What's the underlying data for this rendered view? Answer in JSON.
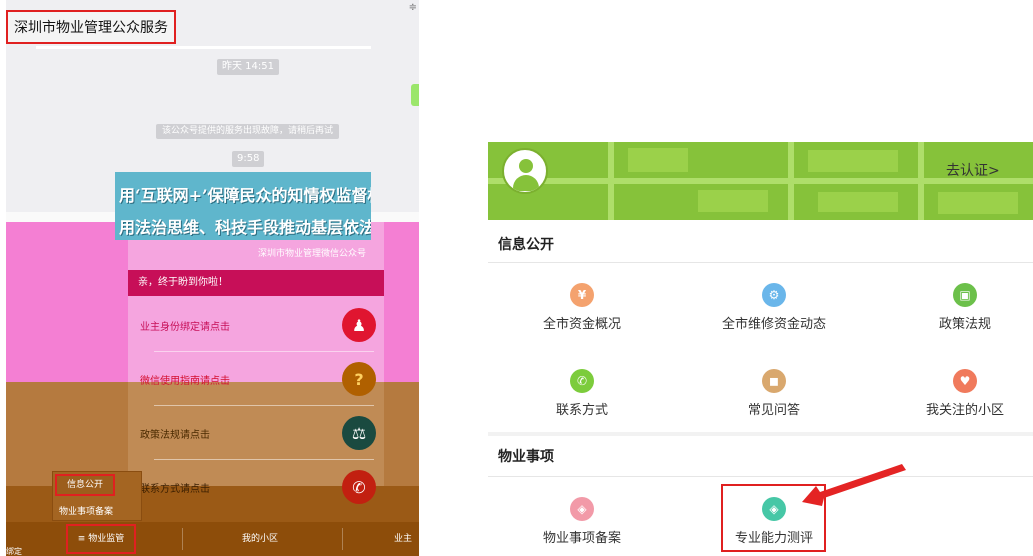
{
  "left": {
    "title": "深圳市物业管理公众服务",
    "corner_dots": "≑",
    "time1": "昨天 14:51",
    "notice": "该公众号提供的服务出现故障，请稍后再试",
    "time2": "9:58",
    "banner_line1": "用‘互联网+’保障民众的知情权监督权",
    "banner_line2": "用法治思维、科技手段推动基层依法治理",
    "banner_sub": "深圳市物业管理微信公众号",
    "welcome": "亲，终于盼到你啦！",
    "menu": [
      {
        "label": "业主身份绑定请点击",
        "icon": "person-lock-icon",
        "glyph": "♟"
      },
      {
        "label": "微信使用指南请点击",
        "icon": "question-icon",
        "glyph": "?"
      },
      {
        "label": "政策法规请点击",
        "icon": "scales-icon",
        "glyph": "⚖"
      },
      {
        "label": "联系方式请点击",
        "icon": "phone-icon",
        "glyph": "✆"
      }
    ],
    "popup": {
      "item1": "信息公开",
      "item2": "物业事项备案"
    },
    "nav": {
      "item1": "≡ 物业监管",
      "item2": "我的小区",
      "item3": "业主身",
      "bind": "绑定"
    }
  },
  "right": {
    "verify": "去认证>",
    "section1": "信息公开",
    "section2": "物业事项",
    "items": [
      {
        "label": "全市资金概况",
        "icon": "funds-icon",
        "glyph": "¥",
        "color": "#f4a26e"
      },
      {
        "label": "全市维修资金动态",
        "icon": "maintenance-gear-icon",
        "glyph": "⚙",
        "color": "#6ab6ea"
      },
      {
        "label": "政策法规",
        "icon": "policy-book-icon",
        "glyph": "▣",
        "color": "#6cc04a"
      },
      {
        "label": "联系方式",
        "icon": "phone-icon",
        "glyph": "✆",
        "color": "#7ccc3c"
      },
      {
        "label": "常见问答",
        "icon": "qa-icon",
        "glyph": "◼",
        "color": "#d9a86e"
      },
      {
        "label": "我关注的小区",
        "icon": "heart-icon",
        "glyph": "♥",
        "color": "#f07a5c"
      },
      {
        "label": "物业事项备案",
        "icon": "record-shield-icon",
        "glyph": "◈",
        "color": "#f29aa8"
      },
      {
        "label": "专业能力测评",
        "icon": "assessment-shield-icon",
        "glyph": "◈",
        "color": "#46c7a6"
      }
    ]
  }
}
